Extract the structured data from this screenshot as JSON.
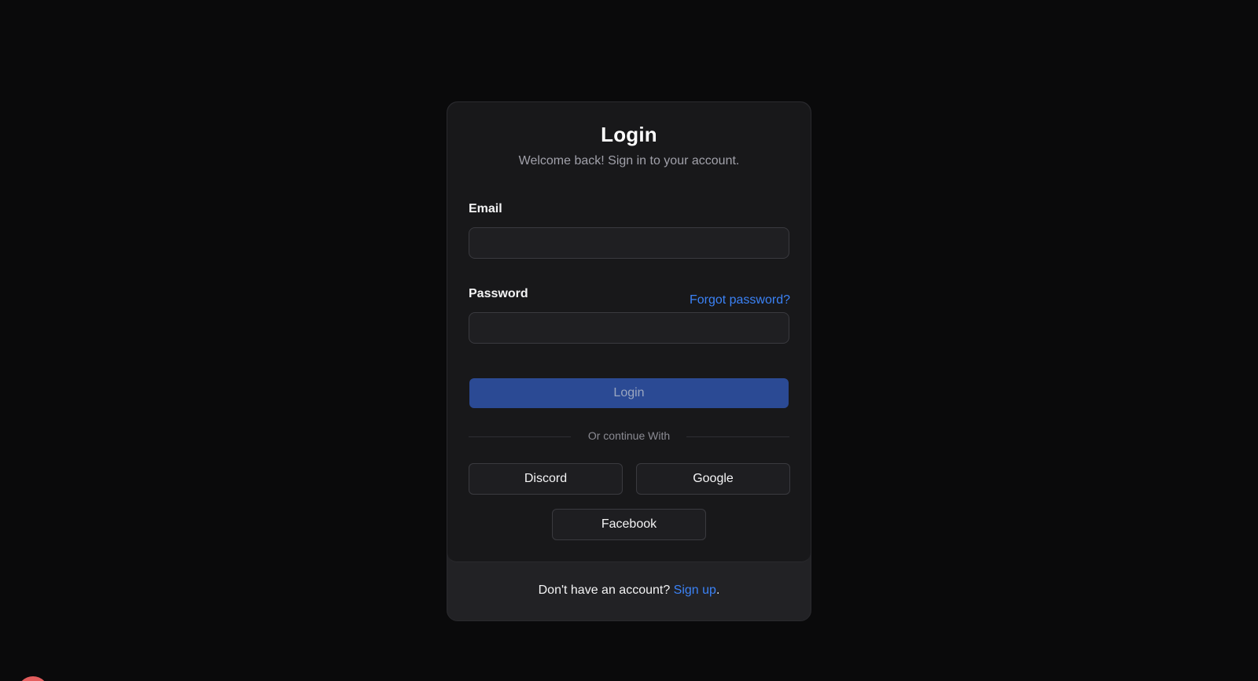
{
  "login_card": {
    "title": "Login",
    "subtitle": "Welcome back! Sign in to your account.",
    "email_label": "Email",
    "email_value": "",
    "password_label": "Password",
    "password_value": "",
    "forgot_password": "Forgot password?",
    "login_button": "Login",
    "divider_text": "Or continue With",
    "social": {
      "discord": "Discord",
      "google": "Google",
      "facebook": "Facebook"
    },
    "footer": {
      "prompt": "Don't have an account?",
      "signup_link": "Sign up",
      "trailing": "."
    }
  },
  "colors": {
    "background": "#0a0a0b",
    "card": "#18181a",
    "link": "#3b82f6",
    "primary_button": "#2b4a94"
  }
}
